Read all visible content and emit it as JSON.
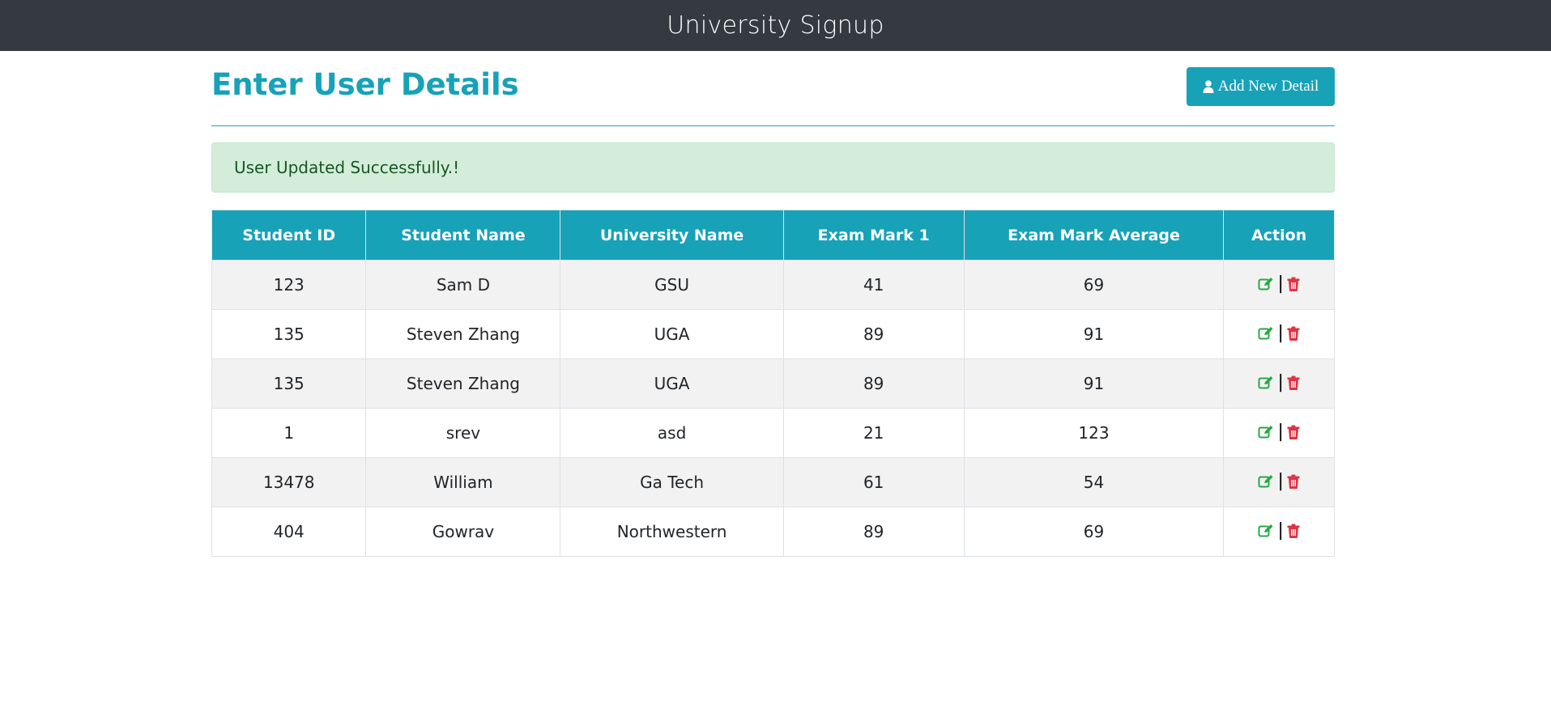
{
  "navbar": {
    "title": "University Signup"
  },
  "page": {
    "title": "Enter User Details",
    "add_button_label": "Add New Detail"
  },
  "alert": {
    "message": "User Updated Successfully.!"
  },
  "table": {
    "headers": [
      "Student ID",
      "Student Name",
      "University Name",
      "Exam Mark 1",
      "Exam Mark Average",
      "Action"
    ],
    "rows": [
      {
        "id": "123",
        "name": "Sam D",
        "university": "GSU",
        "mark1": "41",
        "average": "69"
      },
      {
        "id": "135",
        "name": "Steven Zhang",
        "university": "UGA",
        "mark1": "89",
        "average": "91"
      },
      {
        "id": "135",
        "name": "Steven Zhang",
        "university": "UGA",
        "mark1": "89",
        "average": "91"
      },
      {
        "id": "1",
        "name": "srev",
        "university": "asd",
        "mark1": "21",
        "average": "123"
      },
      {
        "id": "13478",
        "name": "William",
        "university": "Ga Tech",
        "mark1": "61",
        "average": "54"
      },
      {
        "id": "404",
        "name": "Gowrav",
        "university": "Northwestern",
        "mark1": "89",
        "average": "69"
      }
    ],
    "action_separator": "|",
    "action_icons": {
      "edit": "edit-icon",
      "delete": "trash-icon"
    }
  },
  "colors": {
    "navbar_bg": "#343a40",
    "accent": "#17a2b8",
    "alert_bg": "#d4edda",
    "alert_text": "#155724",
    "edit": "#28a745",
    "delete": "#dc3545"
  }
}
